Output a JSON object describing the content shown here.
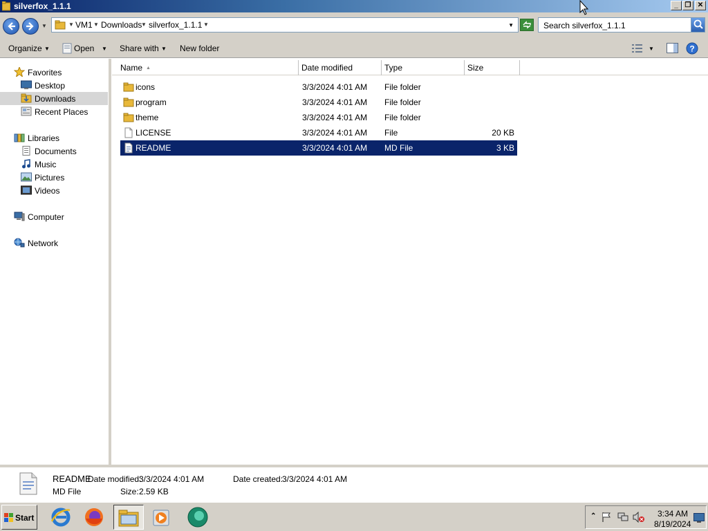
{
  "window": {
    "title": "silverfox_1.1.1",
    "minimize_label": "_",
    "restore_label": "❐",
    "close_label": "✕"
  },
  "address": {
    "crumbs": [
      "VM1",
      "Downloads",
      "silverfox_1.1.1"
    ],
    "search_placeholder": "Search silverfox_1.1.1"
  },
  "toolbar": {
    "organize": "Organize",
    "open": "Open",
    "share_with": "Share with",
    "new_folder": "New folder"
  },
  "nav": {
    "favorites": "Favorites",
    "desktop": "Desktop",
    "downloads": "Downloads",
    "recent_places": "Recent Places",
    "libraries": "Libraries",
    "documents": "Documents",
    "music": "Music",
    "pictures": "Pictures",
    "videos": "Videos",
    "computer": "Computer",
    "network": "Network"
  },
  "columns": {
    "name": "Name",
    "date_modified": "Date modified",
    "type": "Type",
    "size": "Size"
  },
  "files": [
    {
      "name": "icons",
      "date": "3/3/2024 4:01 AM",
      "type": "File folder",
      "size": "",
      "icon": "folder-icon"
    },
    {
      "name": "program",
      "date": "3/3/2024 4:01 AM",
      "type": "File folder",
      "size": "",
      "icon": "folder-icon"
    },
    {
      "name": "theme",
      "date": "3/3/2024 4:01 AM",
      "type": "File folder",
      "size": "",
      "icon": "folder-icon"
    },
    {
      "name": "LICENSE",
      "date": "3/3/2024 4:01 AM",
      "type": "File",
      "size": "20 KB",
      "icon": "file-icon"
    },
    {
      "name": "README",
      "date": "3/3/2024 4:01 AM",
      "type": "MD File",
      "size": "3 KB",
      "icon": "text-file-icon"
    }
  ],
  "details": {
    "name": "README",
    "modified_label": "Date modified:",
    "modified_value": "3/3/2024 4:01 AM",
    "created_label": "Date created:",
    "created_value": "3/3/2024 4:01 AM",
    "type": "MD File",
    "size_label": "Size:",
    "size_value": "2.59 KB"
  },
  "taskbar": {
    "start": "Start",
    "time": "3:34 AM",
    "date": "8/19/2024"
  },
  "colors": {
    "selection": "#0a246a",
    "chrome": "#d4d0c8",
    "folder": "#e8b83a"
  }
}
